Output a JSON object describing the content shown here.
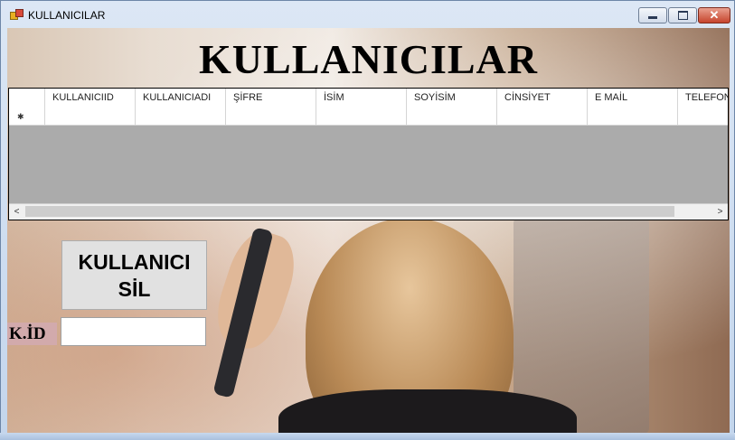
{
  "window": {
    "title": "KULLANICILAR",
    "minimize_glyph": "",
    "maximize_glyph": "",
    "close_glyph": "✕"
  },
  "heading": "KULLANICILAR",
  "grid": {
    "columns": [
      "KULLANICIID",
      "KULLANICIADI",
      "ŞİFRE",
      "İSİM",
      "SOYİSİM",
      "CİNSİYET",
      "E MAİL",
      "TELEFON"
    ],
    "new_row_marker": "✱",
    "scroll_left": "<",
    "scroll_right": ">"
  },
  "delete_button": {
    "line1": "KULLANICI",
    "line2": "SİL"
  },
  "id_field": {
    "label": "K.İD",
    "value": ""
  }
}
